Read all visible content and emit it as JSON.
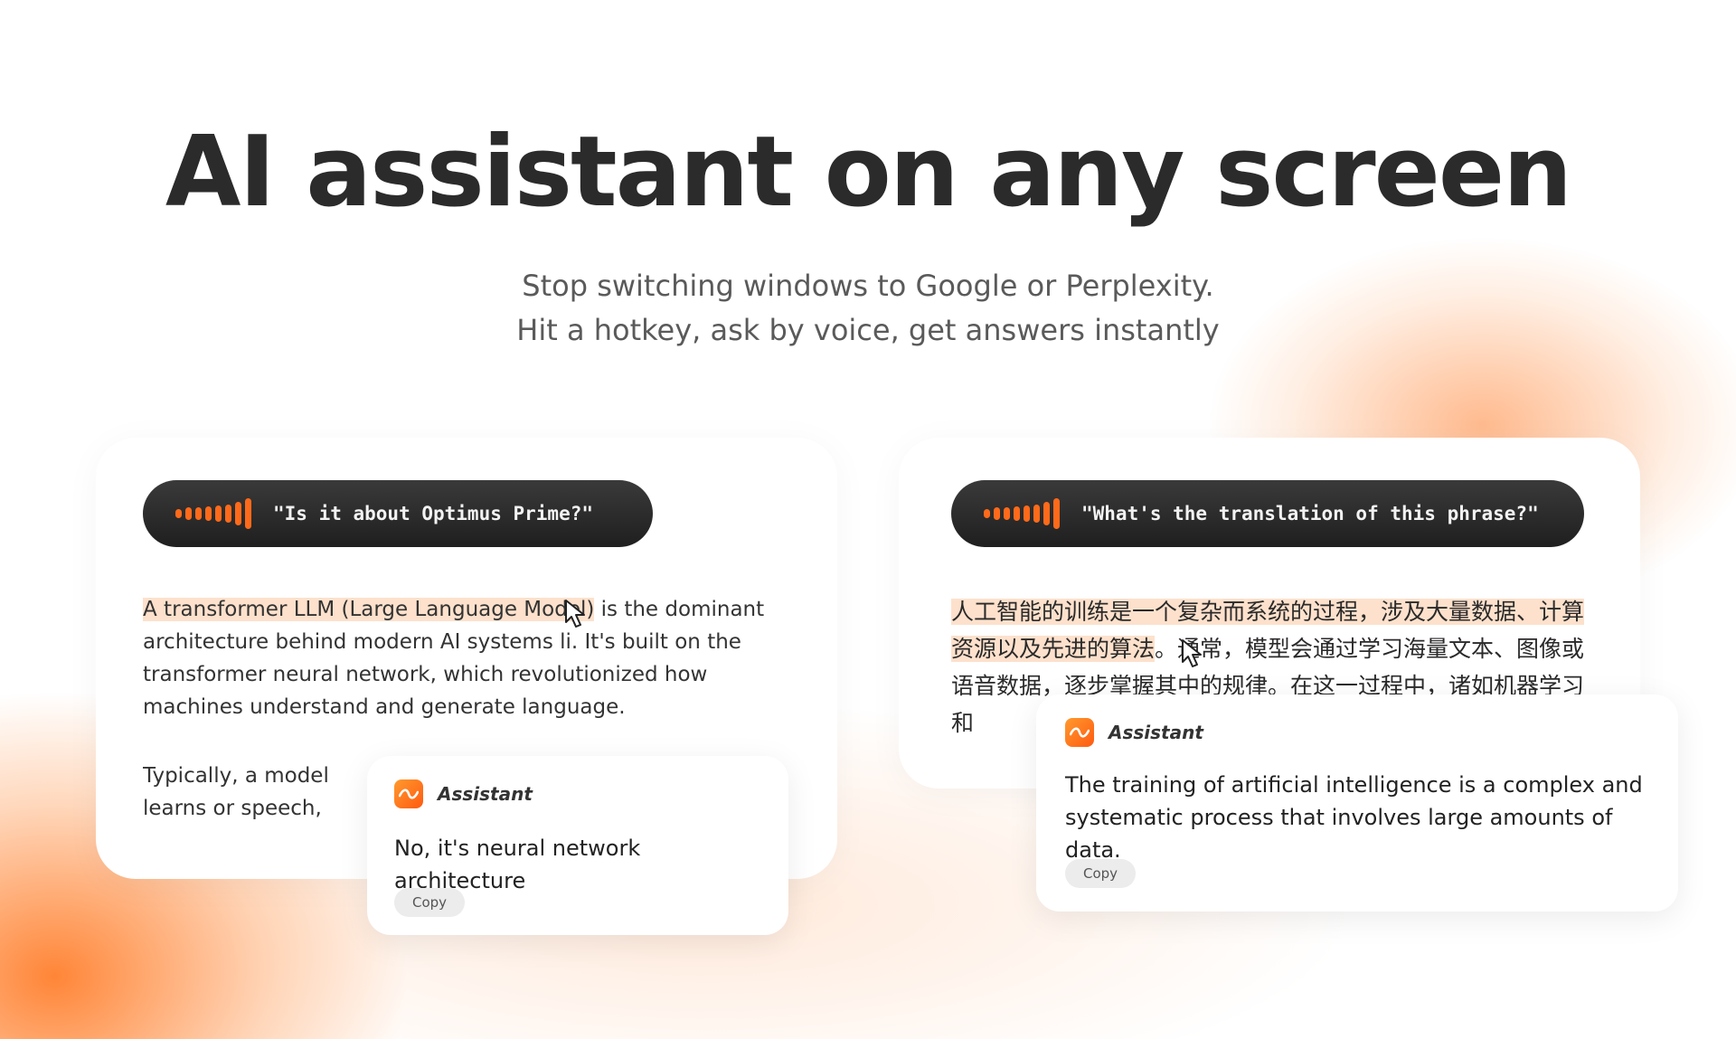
{
  "hero": {
    "title": "AI assistant on any screen",
    "subtitle_line1": "Stop switching windows to Google or Perplexity.",
    "subtitle_line2": "Hit a hotkey, ask by voice, get answers instantly"
  },
  "left_card": {
    "voice_query": "\"Is it about Optimus Prime?\"",
    "paragraph1_highlight": "A transformer LLM (Large Language Model)",
    "paragraph1_rest": " is the dominant architecture behind modern AI systems li. It's built on the transformer neural network, which revolutionized how machines understand and generate language.",
    "paragraph2": "Typically, a model learns or speech, gradually ca"
  },
  "left_popup": {
    "name": "Assistant",
    "answer": "No, it's neural network architecture",
    "copy_label": "Copy"
  },
  "right_card": {
    "voice_query": "\"What's the translation of this phrase?\"",
    "text_highlight": "人工智能的训练是一个复杂而系统的过程，涉及大量数据、计算资源以及先进的算法",
    "text_rest": "。通常，模型会通过学习海量文本、图像或语音数据，逐步掌握其中的规律。在这一过程中，诸如机器学习和"
  },
  "right_popup": {
    "name": "Assistant",
    "answer": "The training of artificial intelligence is a complex and systematic process that involves large amounts of data.",
    "copy_label": "Copy"
  },
  "icons": [
    "voice-wave-icon",
    "assistant-app-icon",
    "mouse-cursor-icon"
  ],
  "colors": {
    "accent": "#ff6a1a",
    "highlight": "#fde1cc",
    "pill": "#2a2a2a"
  }
}
